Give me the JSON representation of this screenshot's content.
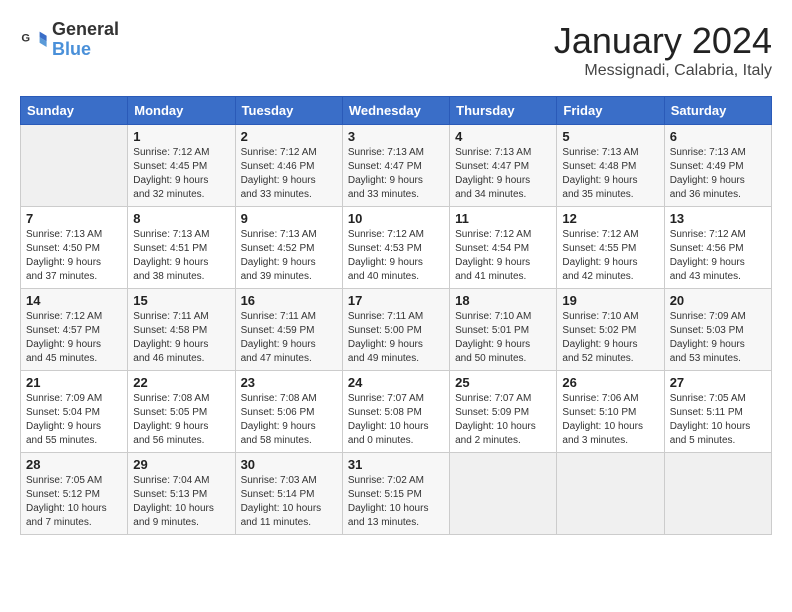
{
  "header": {
    "logo_line1": "General",
    "logo_line2": "Blue",
    "month": "January 2024",
    "location": "Messignadi, Calabria, Italy"
  },
  "weekdays": [
    "Sunday",
    "Monday",
    "Tuesday",
    "Wednesday",
    "Thursday",
    "Friday",
    "Saturday"
  ],
  "weeks": [
    [
      {
        "day": "",
        "info": ""
      },
      {
        "day": "1",
        "info": "Sunrise: 7:12 AM\nSunset: 4:45 PM\nDaylight: 9 hours\nand 32 minutes."
      },
      {
        "day": "2",
        "info": "Sunrise: 7:12 AM\nSunset: 4:46 PM\nDaylight: 9 hours\nand 33 minutes."
      },
      {
        "day": "3",
        "info": "Sunrise: 7:13 AM\nSunset: 4:47 PM\nDaylight: 9 hours\nand 33 minutes."
      },
      {
        "day": "4",
        "info": "Sunrise: 7:13 AM\nSunset: 4:47 PM\nDaylight: 9 hours\nand 34 minutes."
      },
      {
        "day": "5",
        "info": "Sunrise: 7:13 AM\nSunset: 4:48 PM\nDaylight: 9 hours\nand 35 minutes."
      },
      {
        "day": "6",
        "info": "Sunrise: 7:13 AM\nSunset: 4:49 PM\nDaylight: 9 hours\nand 36 minutes."
      }
    ],
    [
      {
        "day": "7",
        "info": "Sunrise: 7:13 AM\nSunset: 4:50 PM\nDaylight: 9 hours\nand 37 minutes."
      },
      {
        "day": "8",
        "info": "Sunrise: 7:13 AM\nSunset: 4:51 PM\nDaylight: 9 hours\nand 38 minutes."
      },
      {
        "day": "9",
        "info": "Sunrise: 7:13 AM\nSunset: 4:52 PM\nDaylight: 9 hours\nand 39 minutes."
      },
      {
        "day": "10",
        "info": "Sunrise: 7:12 AM\nSunset: 4:53 PM\nDaylight: 9 hours\nand 40 minutes."
      },
      {
        "day": "11",
        "info": "Sunrise: 7:12 AM\nSunset: 4:54 PM\nDaylight: 9 hours\nand 41 minutes."
      },
      {
        "day": "12",
        "info": "Sunrise: 7:12 AM\nSunset: 4:55 PM\nDaylight: 9 hours\nand 42 minutes."
      },
      {
        "day": "13",
        "info": "Sunrise: 7:12 AM\nSunset: 4:56 PM\nDaylight: 9 hours\nand 43 minutes."
      }
    ],
    [
      {
        "day": "14",
        "info": "Sunrise: 7:12 AM\nSunset: 4:57 PM\nDaylight: 9 hours\nand 45 minutes."
      },
      {
        "day": "15",
        "info": "Sunrise: 7:11 AM\nSunset: 4:58 PM\nDaylight: 9 hours\nand 46 minutes."
      },
      {
        "day": "16",
        "info": "Sunrise: 7:11 AM\nSunset: 4:59 PM\nDaylight: 9 hours\nand 47 minutes."
      },
      {
        "day": "17",
        "info": "Sunrise: 7:11 AM\nSunset: 5:00 PM\nDaylight: 9 hours\nand 49 minutes."
      },
      {
        "day": "18",
        "info": "Sunrise: 7:10 AM\nSunset: 5:01 PM\nDaylight: 9 hours\nand 50 minutes."
      },
      {
        "day": "19",
        "info": "Sunrise: 7:10 AM\nSunset: 5:02 PM\nDaylight: 9 hours\nand 52 minutes."
      },
      {
        "day": "20",
        "info": "Sunrise: 7:09 AM\nSunset: 5:03 PM\nDaylight: 9 hours\nand 53 minutes."
      }
    ],
    [
      {
        "day": "21",
        "info": "Sunrise: 7:09 AM\nSunset: 5:04 PM\nDaylight: 9 hours\nand 55 minutes."
      },
      {
        "day": "22",
        "info": "Sunrise: 7:08 AM\nSunset: 5:05 PM\nDaylight: 9 hours\nand 56 minutes."
      },
      {
        "day": "23",
        "info": "Sunrise: 7:08 AM\nSunset: 5:06 PM\nDaylight: 9 hours\nand 58 minutes."
      },
      {
        "day": "24",
        "info": "Sunrise: 7:07 AM\nSunset: 5:08 PM\nDaylight: 10 hours\nand 0 minutes."
      },
      {
        "day": "25",
        "info": "Sunrise: 7:07 AM\nSunset: 5:09 PM\nDaylight: 10 hours\nand 2 minutes."
      },
      {
        "day": "26",
        "info": "Sunrise: 7:06 AM\nSunset: 5:10 PM\nDaylight: 10 hours\nand 3 minutes."
      },
      {
        "day": "27",
        "info": "Sunrise: 7:05 AM\nSunset: 5:11 PM\nDaylight: 10 hours\nand 5 minutes."
      }
    ],
    [
      {
        "day": "28",
        "info": "Sunrise: 7:05 AM\nSunset: 5:12 PM\nDaylight: 10 hours\nand 7 minutes."
      },
      {
        "day": "29",
        "info": "Sunrise: 7:04 AM\nSunset: 5:13 PM\nDaylight: 10 hours\nand 9 minutes."
      },
      {
        "day": "30",
        "info": "Sunrise: 7:03 AM\nSunset: 5:14 PM\nDaylight: 10 hours\nand 11 minutes."
      },
      {
        "day": "31",
        "info": "Sunrise: 7:02 AM\nSunset: 5:15 PM\nDaylight: 10 hours\nand 13 minutes."
      },
      {
        "day": "",
        "info": ""
      },
      {
        "day": "",
        "info": ""
      },
      {
        "day": "",
        "info": ""
      }
    ]
  ]
}
